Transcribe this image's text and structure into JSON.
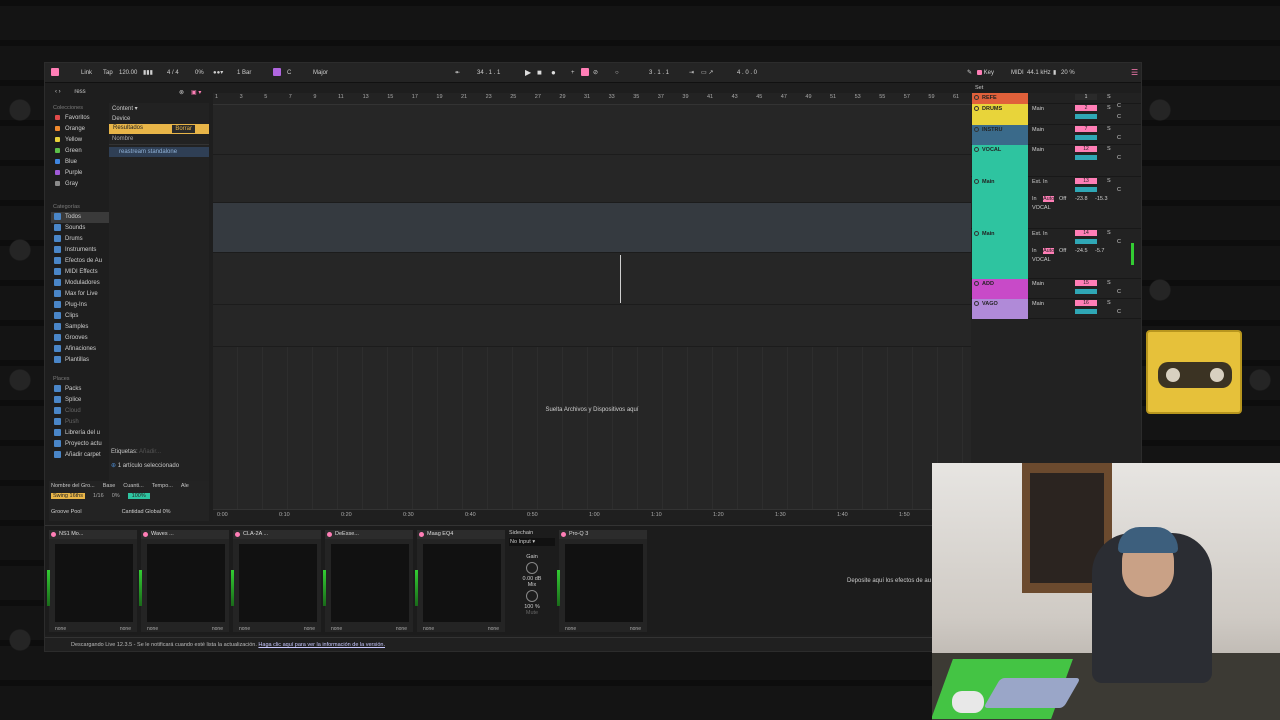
{
  "topbar": {
    "link": "Link",
    "tap": "Tap",
    "tempo": "120.00",
    "signature": "4 / 4",
    "cpu_pct": "0%",
    "quantize": "1 Bar",
    "key": "C",
    "scale": "Major",
    "position": "34 . 1 . 1",
    "loop_start": "3 . 1 . 1",
    "loop_len": "4 . 0 . 0",
    "key_map": "Key",
    "midi_map": "MIDI",
    "sample_rate": "44.1 kHz",
    "cpu_load": "20 %"
  },
  "browser": {
    "search_value": "ress",
    "collections_title": "Colecciones",
    "collections": [
      {
        "label": "Favoritos",
        "color": "#e04a4a"
      },
      {
        "label": "Orange",
        "color": "#f08a2e"
      },
      {
        "label": "Yellow",
        "color": "#e8d13a"
      },
      {
        "label": "Green",
        "color": "#5cc04a"
      },
      {
        "label": "Blue",
        "color": "#3f86e0"
      },
      {
        "label": "Purple",
        "color": "#a05ad8"
      },
      {
        "label": "Gray",
        "color": "#8a8a8a"
      }
    ],
    "categories_title": "Categorías",
    "categories": [
      "Todos",
      "Sounds",
      "Drums",
      "Instruments",
      "Efectos de Au",
      "MIDI Effects",
      "Moduladores",
      "Max for Live",
      "Plug-Ins",
      "Clips",
      "Samples",
      "Grooves",
      "Afinaciones",
      "Plantillas"
    ],
    "places_title": "Places",
    "places": [
      "Packs",
      "Splice",
      "Cloud",
      "Push",
      "Librería del u",
      "Proyecto actu",
      "Añadir carpet"
    ],
    "content_label": "Content",
    "device_label": "Device",
    "results_label": "Resultados",
    "clear_label": "Borrar",
    "name_header": "Nombre",
    "result_file": "reastream standalone",
    "tags_label": "Etiquetas:",
    "tags_placeholder": "Añadir...",
    "selection_status": "1 artículo seleccionado",
    "groove_headers": [
      "Nombre del Gro...",
      "Base",
      "Cuanti...",
      "Tempo...",
      "Ale"
    ],
    "groove_row": {
      "name": "Swing 16ths",
      "base": "1/16",
      "quant": "0%",
      "tempo": "100%"
    },
    "groove_pool": "Groove Pool",
    "global_amount_label": "Cantidad Global",
    "global_amount": "0%"
  },
  "arrangement": {
    "bar_numbers": [
      "1",
      "3",
      "5",
      "7",
      "9",
      "11",
      "13",
      "15",
      "17",
      "19",
      "21",
      "23",
      "25",
      "27",
      "29",
      "31",
      "33",
      "35",
      "37",
      "39",
      "41",
      "43",
      "45",
      "47",
      "49",
      "51",
      "53",
      "55",
      "57",
      "59",
      "61"
    ],
    "time_marks": [
      "0:00",
      "0:10",
      "0:20",
      "0:30",
      "0:40",
      "0:50",
      "1:00",
      "1:10",
      "1:20",
      "1:30",
      "1:40",
      "1:50"
    ],
    "drop_hint": "Suelta Archivos y Dispositivos aquí",
    "set_label": "Set"
  },
  "tracks": [
    {
      "name": "REFE",
      "color": "#e0603a",
      "out": "",
      "num": "1",
      "num_color": "#2a2a2a"
    },
    {
      "name": "DRUMS",
      "color": "#e8d43a",
      "out": "Main",
      "num": "2",
      "num_color": "#ff7eb6"
    },
    {
      "name": "INSTRU",
      "color": "#3a6a8a",
      "out": "Main",
      "num": "7",
      "num_color": "#ff7eb6"
    },
    {
      "name": "VOCAL",
      "color": "#2ec4a0",
      "out": "Main",
      "num": "12",
      "num_color": "#ff7eb6"
    },
    {
      "name": "Main",
      "color": "#2ec4a0",
      "out": "Ext. In",
      "num": "13",
      "num_color": "#ff7eb6",
      "io": "VOCAL",
      "in_val": "-23.8",
      "out_val": "-15.3"
    },
    {
      "name": "Main",
      "color": "#2ec4a0",
      "out": "Ext. In",
      "num": "14",
      "num_color": "#ff7eb6",
      "io": "VOCAL",
      "in_val": "-24.5",
      "out_val": "-5.7"
    },
    {
      "name": "ADD",
      "color": "#c84ac8",
      "out": "Main",
      "num": "15",
      "num_color": "#ff7eb6"
    },
    {
      "name": "VAGO",
      "color": "#b08ad8",
      "out": "Main",
      "num": "16",
      "num_color": "#ff7eb6"
    }
  ],
  "track_labels": {
    "in": "In",
    "auto": "Auto",
    "off": "Off",
    "solo": "S",
    "cue": "C"
  },
  "devices": [
    {
      "title": "NS1 Mo...",
      "foot_left": "none",
      "foot_right": "none"
    },
    {
      "title": "Waves ...",
      "foot_left": "none",
      "foot_right": "none"
    },
    {
      "title": "CLA-2A ...",
      "foot_left": "none",
      "foot_right": "none"
    },
    {
      "title": "DeEsse...",
      "foot_left": "none",
      "foot_right": "none"
    },
    {
      "title": "Maag EQ4",
      "foot_left": "none",
      "foot_right": "none"
    },
    {
      "title": "Pro-Q 3",
      "foot_left": "none",
      "foot_right": "none"
    }
  ],
  "sidechain": {
    "label": "Sidechain",
    "input": "No Input",
    "gain_label": "Gain",
    "gain_value": "0.00 dB",
    "mix_label": "Mix",
    "mix_value": "100 %",
    "mute": "Mute"
  },
  "device_drop_hint": "Deposite aquí los efectos de au",
  "status_bar": {
    "message": "Descargando Live 12.3.5 - Se le notificará cuando esté lista la actualización.",
    "link_text": "Haga clic aquí para ver la información de la versión."
  },
  "colors": {
    "accent": "#ff7eb6",
    "teal": "#2ec4a0",
    "results": "#e8b548"
  }
}
